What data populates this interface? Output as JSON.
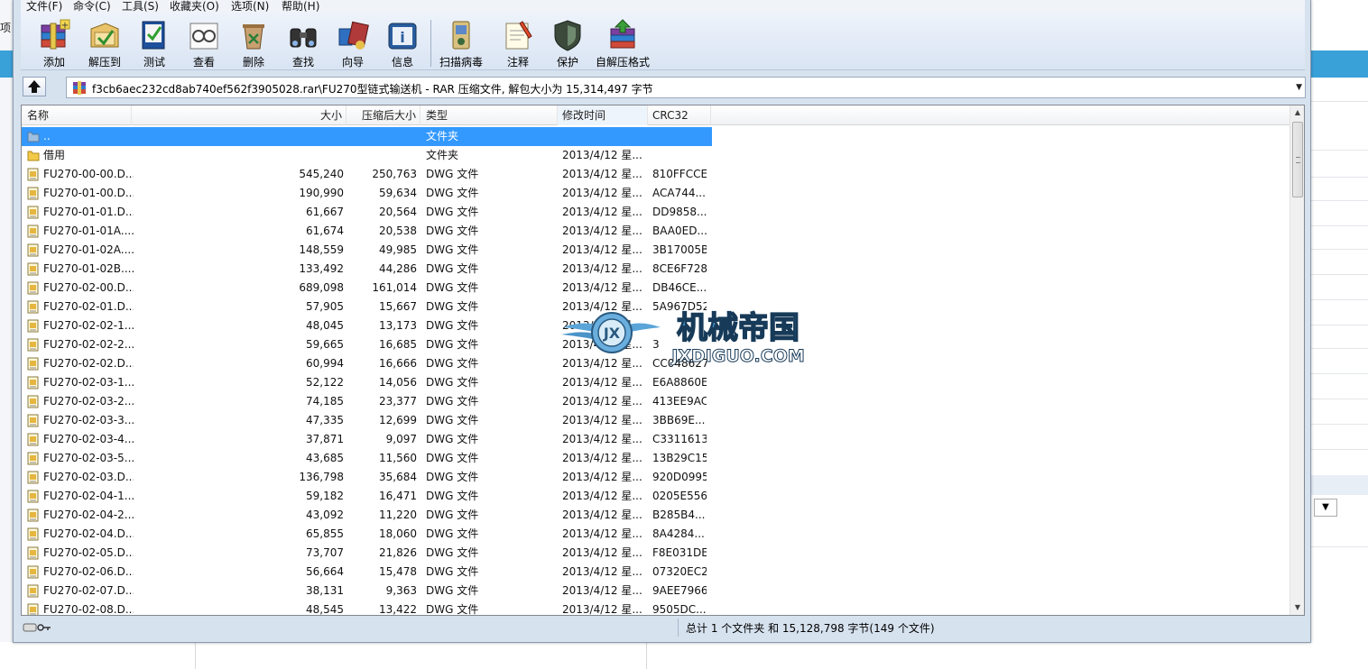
{
  "background_app": {
    "left_label": "项",
    "dropdown_arrow": "▼"
  },
  "menu": [
    {
      "label": "文件(F)"
    },
    {
      "label": "命令(C)"
    },
    {
      "label": "工具(S)"
    },
    {
      "label": "收藏夹(O)"
    },
    {
      "label": "选项(N)"
    },
    {
      "label": "帮助(H)"
    }
  ],
  "toolbar": [
    {
      "label": "添加",
      "icon": "add-archive-icon"
    },
    {
      "label": "解压到",
      "icon": "extract-to-icon"
    },
    {
      "label": "测试",
      "icon": "test-icon"
    },
    {
      "label": "查看",
      "icon": "view-icon"
    },
    {
      "label": "删除",
      "icon": "delete-icon"
    },
    {
      "label": "查找",
      "icon": "find-icon"
    },
    {
      "label": "向导",
      "icon": "wizard-icon"
    },
    {
      "label": "信息",
      "icon": "info-icon"
    },
    {
      "label": "扫描病毒",
      "icon": "virus-scan-icon"
    },
    {
      "label": "注释",
      "icon": "comment-icon"
    },
    {
      "label": "保护",
      "icon": "protect-icon"
    },
    {
      "label": "自解压格式",
      "icon": "sfx-icon"
    }
  ],
  "address": {
    "path": "f3cb6aec232cd8ab740ef562f3905028.rar\\FU270型链式输送机 - RAR 压缩文件, 解包大小为 15,314,497 字节"
  },
  "columns": {
    "name": "名称",
    "size": "大小",
    "packed": "压缩后大小",
    "type": "类型",
    "modified": "修改时间",
    "crc": "CRC32"
  },
  "rows": [
    {
      "name": "..",
      "size": "",
      "packed": "",
      "type": "文件夹",
      "modified": "",
      "crc": "",
      "kind": "up",
      "selected": true
    },
    {
      "name": "借用",
      "size": "",
      "packed": "",
      "type": "文件夹",
      "modified": "2013/4/12 星...",
      "crc": "",
      "kind": "folder"
    },
    {
      "name": "FU270-00-00.D...",
      "size": "545,240",
      "packed": "250,763",
      "type": "DWG 文件",
      "modified": "2013/4/12 星...",
      "crc": "810FFCCE",
      "kind": "file"
    },
    {
      "name": "FU270-01-00.D...",
      "size": "190,990",
      "packed": "59,634",
      "type": "DWG 文件",
      "modified": "2013/4/12 星...",
      "crc": "ACA744...",
      "kind": "file"
    },
    {
      "name": "FU270-01-01.D...",
      "size": "61,667",
      "packed": "20,564",
      "type": "DWG 文件",
      "modified": "2013/4/12 星...",
      "crc": "DD9858...",
      "kind": "file"
    },
    {
      "name": "FU270-01-01A....",
      "size": "61,674",
      "packed": "20,538",
      "type": "DWG 文件",
      "modified": "2013/4/12 星...",
      "crc": "BAA0ED...",
      "kind": "file"
    },
    {
      "name": "FU270-01-02A....",
      "size": "148,559",
      "packed": "49,985",
      "type": "DWG 文件",
      "modified": "2013/4/12 星...",
      "crc": "3B17005B",
      "kind": "file"
    },
    {
      "name": "FU270-01-02B....",
      "size": "133,492",
      "packed": "44,286",
      "type": "DWG 文件",
      "modified": "2013/4/12 星...",
      "crc": "8CE6F728",
      "kind": "file"
    },
    {
      "name": "FU270-02-00.D...",
      "size": "689,098",
      "packed": "161,014",
      "type": "DWG 文件",
      "modified": "2013/4/12 星...",
      "crc": "DB46CE...",
      "kind": "file"
    },
    {
      "name": "FU270-02-01.D...",
      "size": "57,905",
      "packed": "15,667",
      "type": "DWG 文件",
      "modified": "2013/4/12 星...",
      "crc": "5A967D52",
      "kind": "file"
    },
    {
      "name": "FU270-02-02-1...",
      "size": "48,045",
      "packed": "13,173",
      "type": "DWG 文件",
      "modified": "2013/4/12 星...",
      "crc": "",
      "kind": "file"
    },
    {
      "name": "FU270-02-02-2...",
      "size": "59,665",
      "packed": "16,685",
      "type": "DWG 文件",
      "modified": "2013/4/12 星...",
      "crc": "3",
      "kind": "file"
    },
    {
      "name": "FU270-02-02.D...",
      "size": "60,994",
      "packed": "16,666",
      "type": "DWG 文件",
      "modified": "2013/4/12 星...",
      "crc": "CC048627",
      "kind": "file"
    },
    {
      "name": "FU270-02-03-1...",
      "size": "52,122",
      "packed": "14,056",
      "type": "DWG 文件",
      "modified": "2013/4/12 星...",
      "crc": "E6A8860E",
      "kind": "file"
    },
    {
      "name": "FU270-02-03-2...",
      "size": "74,185",
      "packed": "23,377",
      "type": "DWG 文件",
      "modified": "2013/4/12 星...",
      "crc": "413EE9AC",
      "kind": "file"
    },
    {
      "name": "FU270-02-03-3...",
      "size": "47,335",
      "packed": "12,699",
      "type": "DWG 文件",
      "modified": "2013/4/12 星...",
      "crc": "3BB69E...",
      "kind": "file"
    },
    {
      "name": "FU270-02-03-4...",
      "size": "37,871",
      "packed": "9,097",
      "type": "DWG 文件",
      "modified": "2013/4/12 星...",
      "crc": "C3311613",
      "kind": "file"
    },
    {
      "name": "FU270-02-03-5...",
      "size": "43,685",
      "packed": "11,560",
      "type": "DWG 文件",
      "modified": "2013/4/12 星...",
      "crc": "13B29C15",
      "kind": "file"
    },
    {
      "name": "FU270-02-03.D...",
      "size": "136,798",
      "packed": "35,684",
      "type": "DWG 文件",
      "modified": "2013/4/12 星...",
      "crc": "920D0995",
      "kind": "file"
    },
    {
      "name": "FU270-02-04-1...",
      "size": "59,182",
      "packed": "16,471",
      "type": "DWG 文件",
      "modified": "2013/4/12 星...",
      "crc": "0205E556",
      "kind": "file"
    },
    {
      "name": "FU270-02-04-2...",
      "size": "43,092",
      "packed": "11,220",
      "type": "DWG 文件",
      "modified": "2013/4/12 星...",
      "crc": "B285B4...",
      "kind": "file"
    },
    {
      "name": "FU270-02-04.D...",
      "size": "65,855",
      "packed": "18,060",
      "type": "DWG 文件",
      "modified": "2013/4/12 星...",
      "crc": "8A4284...",
      "kind": "file"
    },
    {
      "name": "FU270-02-05.D...",
      "size": "73,707",
      "packed": "21,826",
      "type": "DWG 文件",
      "modified": "2013/4/12 星...",
      "crc": "F8E031DE",
      "kind": "file"
    },
    {
      "name": "FU270-02-06.D...",
      "size": "56,664",
      "packed": "15,478",
      "type": "DWG 文件",
      "modified": "2013/4/12 星...",
      "crc": "07320EC2",
      "kind": "file"
    },
    {
      "name": "FU270-02-07.D...",
      "size": "38,131",
      "packed": "9,363",
      "type": "DWG 文件",
      "modified": "2013/4/12 星...",
      "crc": "9AEE7966",
      "kind": "file"
    },
    {
      "name": "FU270-02-08.D...",
      "size": "48,545",
      "packed": "13,422",
      "type": "DWG 文件",
      "modified": "2013/4/12 星...",
      "crc": "9505DC...",
      "kind": "file"
    }
  ],
  "watermark": {
    "title": "机械帝国",
    "url": "JXDIGUO.COM",
    "emblem": "JX"
  },
  "status": {
    "summary": "总计 1 个文件夹 和 15,128,798 字节(149 个文件)"
  },
  "colors": {
    "selection": "#3399ff",
    "toolbar_bg": "#dbe6f4",
    "background_accent": "#3aa0d8"
  }
}
